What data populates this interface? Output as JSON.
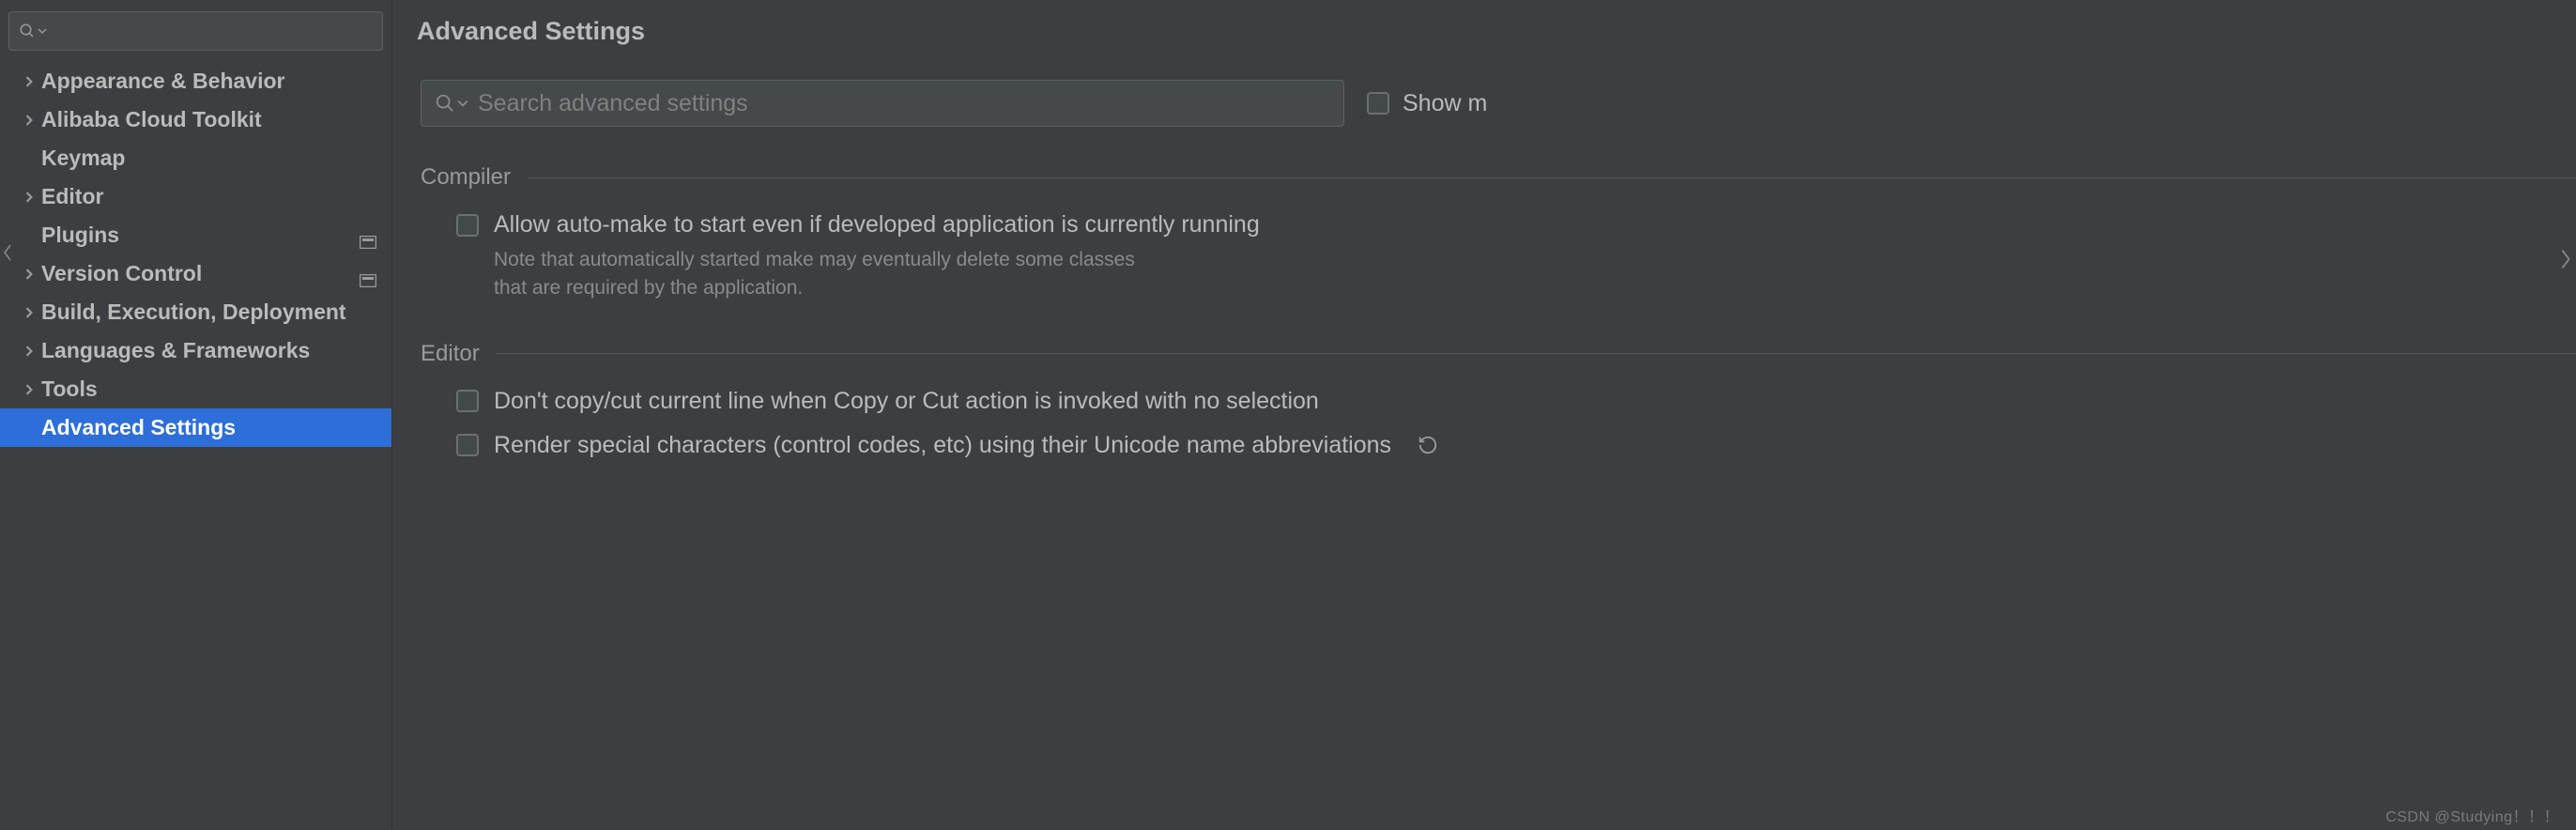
{
  "sidebar": {
    "items": [
      {
        "label": "Appearance & Behavior",
        "expandable": true,
        "badge": false
      },
      {
        "label": "Alibaba Cloud Toolkit",
        "expandable": true,
        "badge": false
      },
      {
        "label": "Keymap",
        "expandable": false,
        "badge": false
      },
      {
        "label": "Editor",
        "expandable": true,
        "badge": false
      },
      {
        "label": "Plugins",
        "expandable": false,
        "badge": true
      },
      {
        "label": "Version Control",
        "expandable": true,
        "badge": true
      },
      {
        "label": "Build, Execution, Deployment",
        "expandable": true,
        "badge": false
      },
      {
        "label": "Languages & Frameworks",
        "expandable": true,
        "badge": false
      },
      {
        "label": "Tools",
        "expandable": true,
        "badge": false
      },
      {
        "label": "Advanced Settings",
        "expandable": false,
        "badge": false,
        "selected": true
      }
    ]
  },
  "main": {
    "title": "Advanced Settings",
    "search_placeholder": "Search advanced settings",
    "show_label": "Show m",
    "sections": {
      "compiler": {
        "title": "Compiler",
        "opt1_label": "Allow auto-make to start even if developed application is currently running",
        "opt1_note1": "Note that automatically started make may eventually delete some classes",
        "opt1_note2": "that are required by the application."
      },
      "editor": {
        "title": "Editor",
        "opt1_label": "Don't copy/cut current line when Copy or Cut action is invoked with no selection",
        "opt2_label": "Render special characters (control codes, etc) using their Unicode name abbreviations"
      }
    }
  },
  "watermark": "CSDN @Studying！！！"
}
